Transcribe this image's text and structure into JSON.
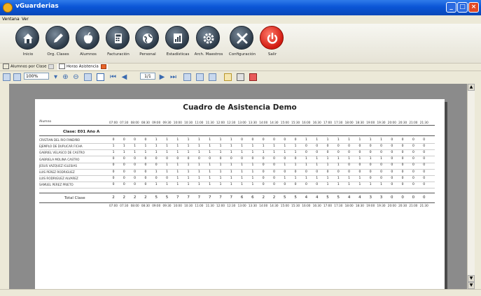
{
  "window": {
    "title": "vGuarderias"
  },
  "menu": [
    "Ventana",
    "Ver"
  ],
  "ribbon": [
    {
      "label": "Inicio",
      "icon": "home-icon"
    },
    {
      "label": "Org. Clases",
      "icon": "pencil-icon"
    },
    {
      "label": "Alumnos",
      "icon": "apple-icon"
    },
    {
      "label": "Facturación",
      "icon": "calculator-icon"
    },
    {
      "label": "Personal",
      "icon": "globe-icon"
    },
    {
      "label": "Estadísticas",
      "icon": "stats-icon"
    },
    {
      "label": "Arch. Maestros",
      "icon": "gear-icon"
    },
    {
      "label": "Configuración",
      "icon": "tools-icon"
    },
    {
      "label": "Salir",
      "icon": "power-icon"
    }
  ],
  "tabs": [
    {
      "label": "Alumnos por Clase",
      "active": false
    },
    {
      "label": "Horas Asistencia",
      "active": true
    }
  ],
  "toolbar": {
    "zoom": "100%",
    "page": "1",
    "page_total": "/1"
  },
  "report": {
    "title": "Cuadro de Asistencia Demo",
    "alumno_label": "Alumno",
    "hours": [
      "07:00",
      "07:30",
      "08:00",
      "08:30",
      "09:00",
      "09:30",
      "10:00",
      "10:30",
      "11:00",
      "11:30",
      "12:00",
      "12:30",
      "13:00",
      "13:30",
      "14:00",
      "14:30",
      "15:00",
      "15:30",
      "16:00",
      "16:30",
      "17:00",
      "17:30",
      "18:00",
      "18:30",
      "19:00",
      "19:30",
      "20:00",
      "20:30",
      "21:00",
      "21:30"
    ],
    "clase": "Clase: E01 Año A",
    "students": [
      {
        "name": "CRISTIAN DEL RIO FANDIÑO",
        "values": [
          0,
          0,
          0,
          0,
          1,
          1,
          1,
          1,
          1,
          1,
          1,
          1,
          0,
          0,
          0,
          0,
          0,
          0,
          1,
          1,
          1,
          1,
          1,
          1,
          1,
          1,
          0,
          0,
          0,
          0
        ]
      },
      {
        "name": "EJEMPLO DE DUPLICAR FICHA",
        "values": [
          1,
          1,
          1,
          1,
          1,
          1,
          1,
          1,
          1,
          1,
          1,
          1,
          1,
          1,
          1,
          1,
          1,
          1,
          0,
          0,
          0,
          0,
          0,
          0,
          0,
          0,
          0,
          0,
          0,
          0
        ]
      },
      {
        "name": "GABRIEL VELASCO DE CASTRO",
        "values": [
          1,
          1,
          1,
          1,
          1,
          1,
          1,
          1,
          1,
          1,
          1,
          1,
          1,
          1,
          1,
          1,
          1,
          1,
          0,
          0,
          0,
          0,
          0,
          0,
          0,
          0,
          0,
          0,
          0,
          0
        ]
      },
      {
        "name": "GABRIELA MOLINA CASTRO",
        "values": [
          0,
          0,
          0,
          0,
          0,
          0,
          0,
          0,
          0,
          0,
          0,
          0,
          0,
          0,
          0,
          0,
          0,
          0,
          1,
          1,
          1,
          1,
          1,
          1,
          1,
          1,
          0,
          0,
          0,
          0
        ]
      },
      {
        "name": "JESUS VAZQUEZ IGLESIAS",
        "values": [
          0,
          0,
          0,
          0,
          0,
          1,
          1,
          1,
          1,
          1,
          1,
          1,
          1,
          1,
          0,
          0,
          1,
          1,
          1,
          1,
          1,
          1,
          0,
          0,
          0,
          0,
          0,
          0,
          0,
          0
        ]
      },
      {
        "name": "LUIS PEREZ RODRIGUEZ",
        "values": [
          0,
          0,
          0,
          0,
          1,
          1,
          1,
          1,
          1,
          1,
          1,
          1,
          1,
          1,
          0,
          0,
          0,
          0,
          0,
          0,
          0,
          0,
          0,
          0,
          0,
          0,
          0,
          0,
          0,
          0
        ]
      },
      {
        "name": "LUIS RODRIGUEZ ALVAREZ",
        "values": [
          0,
          0,
          0,
          0,
          0,
          0,
          1,
          1,
          1,
          1,
          1,
          1,
          1,
          1,
          0,
          0,
          1,
          1,
          1,
          1,
          1,
          1,
          1,
          1,
          0,
          0,
          0,
          0,
          0,
          0
        ]
      },
      {
        "name": "SAMUEL PEREZ PRIETO",
        "values": [
          0,
          0,
          0,
          0,
          1,
          1,
          1,
          1,
          1,
          1,
          1,
          1,
          1,
          1,
          0,
          0,
          0,
          0,
          0,
          0,
          1,
          1,
          1,
          1,
          1,
          1,
          0,
          0,
          0,
          0
        ]
      }
    ],
    "total_label": "Total Clase",
    "totals": [
      2,
      2,
      2,
      2,
      5,
      5,
      7,
      7,
      7,
      7,
      7,
      7,
      6,
      6,
      2,
      2,
      5,
      5,
      4,
      4,
      5,
      5,
      4,
      4,
      3,
      3,
      0,
      0,
      0,
      0
    ]
  },
  "colors": {
    "titlebar": "#0a55d6",
    "viewer_bg": "#8b8b8b",
    "close_tab": "#e8652a",
    "exit_button": "#d11a10"
  }
}
